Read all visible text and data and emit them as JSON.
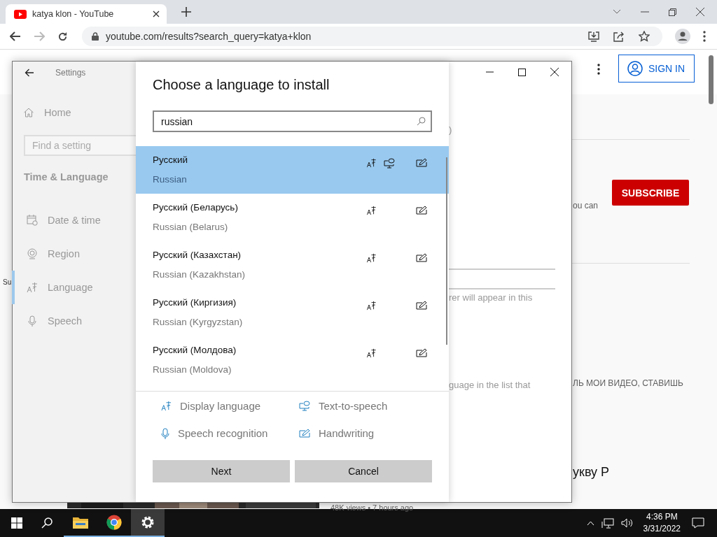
{
  "browser": {
    "tab": {
      "title": "katya klon - YouTube"
    },
    "address": "youtube.com/results?search_query=katya+klon"
  },
  "page_behind": {
    "sign_in": "SIGN IN",
    "subscribe": "SUBSCRIBE",
    "channel_text": "ou can",
    "description_text": "ЛЬ МОИ ВИДЕО, СТАВИШЬ",
    "video_title": "укву Р",
    "video_meta": "48K views • 7 hours ago",
    "edge_text": "Su"
  },
  "settings": {
    "title": "Settings",
    "home": "Home",
    "search": {
      "placeholder": "Find a setting"
    },
    "section": "Time & Language",
    "items": [
      {
        "label": "Date & time",
        "selected": false
      },
      {
        "label": "Region",
        "selected": false
      },
      {
        "label": "Language",
        "selected": true
      },
      {
        "label": "Speech",
        "selected": false
      }
    ],
    "pane_texts": [
      ")",
      "rer will appear in this",
      "guage in the list that"
    ]
  },
  "dialog": {
    "title": "Choose a language to install",
    "search": {
      "value": "russian"
    },
    "languages": [
      {
        "native": "Русский",
        "english": "Russian",
        "selected": true,
        "display_language": true,
        "text_to_speech": true,
        "handwriting": true
      },
      {
        "native": "Русский (Беларусь)",
        "english": "Russian (Belarus)",
        "selected": false,
        "display_language": true,
        "text_to_speech": false,
        "handwriting": true
      },
      {
        "native": "Русский (Казахстан)",
        "english": "Russian (Kazakhstan)",
        "selected": false,
        "display_language": true,
        "text_to_speech": false,
        "handwriting": true
      },
      {
        "native": "Русский (Киргизия)",
        "english": "Russian (Kyrgyzstan)",
        "selected": false,
        "display_language": true,
        "text_to_speech": false,
        "handwriting": true
      },
      {
        "native": "Русский (Молдова)",
        "english": "Russian (Moldova)",
        "selected": false,
        "display_language": true,
        "text_to_speech": false,
        "handwriting": true
      }
    ],
    "legend": [
      {
        "kind": "display",
        "label": "Display language"
      },
      {
        "kind": "tts",
        "label": "Text-to-speech"
      },
      {
        "kind": "speech",
        "label": "Speech recognition"
      },
      {
        "kind": "handwriting",
        "label": "Handwriting"
      }
    ],
    "buttons": [
      "Next",
      "Cancel"
    ]
  },
  "taskbar": {
    "apps": [
      {
        "kind": "explorer",
        "selected": false
      },
      {
        "kind": "chrome",
        "selected": false
      },
      {
        "kind": "settings",
        "selected": true
      }
    ],
    "time": "4:36 PM",
    "date": "3/31/2022"
  }
}
